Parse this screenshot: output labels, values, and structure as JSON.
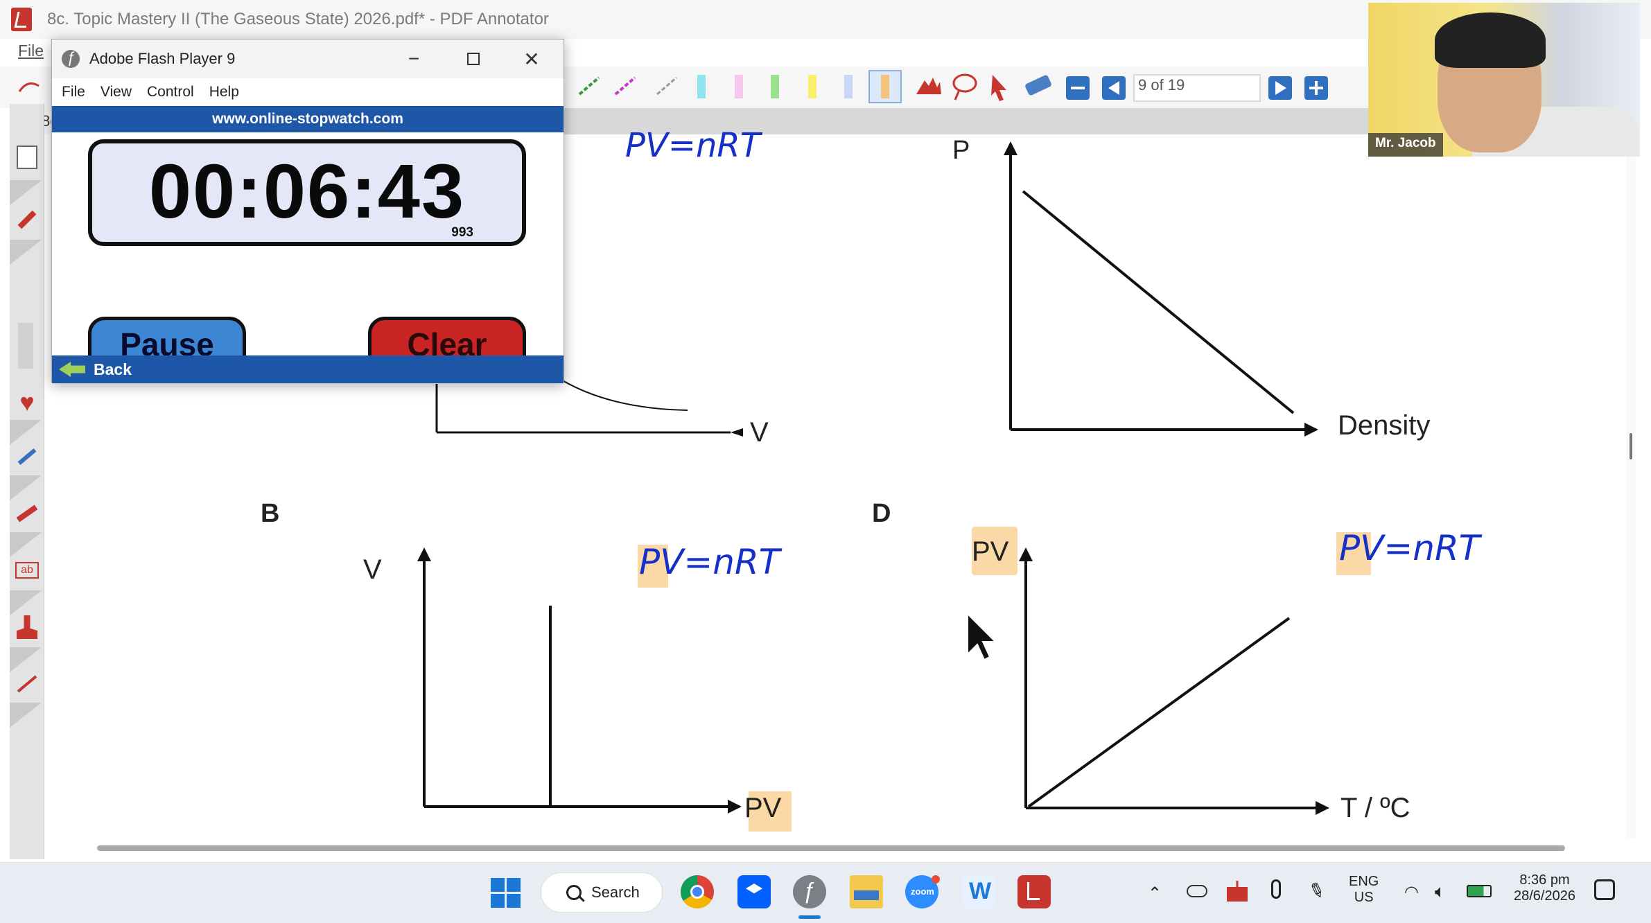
{
  "app": {
    "title": "8c. Topic Mastery II (The Gaseous State) 2026.pdf* - PDF Annotator",
    "menu_file": "File",
    "tab_label": "8c",
    "page_indicator": "9 of 19"
  },
  "flash_window": {
    "title": "Adobe Flash Player 9",
    "menu": [
      "File",
      "View",
      "Control",
      "Help"
    ],
    "site": "www.online-stopwatch.com",
    "time": "00:06:43",
    "milliseconds": "993",
    "pause_label": "Pause",
    "clear_label": "Clear",
    "back_label": "Back"
  },
  "webcam": {
    "name": "Mr. Jacob"
  },
  "document": {
    "handwriting_top": "PV=nRT",
    "graph_a": {
      "x_label": "V"
    },
    "graph_c": {
      "y_label": "P",
      "x_label": "Density"
    },
    "graph_b": {
      "letter": "B",
      "y_label": "V",
      "x_label": "PV",
      "note": "PV=nRT"
    },
    "graph_d": {
      "letter": "D",
      "y_label": "PV",
      "x_label": "T / ºC",
      "note": "PV=nRT"
    }
  },
  "taskbar": {
    "search_label": "Search",
    "lang_top": "ENG",
    "lang_bottom": "US",
    "time": "8:36 pm",
    "date": "28/6/2026",
    "apps": [
      "start",
      "chrome",
      "dropbox",
      "flash",
      "file-explorer",
      "zoom",
      "w-app",
      "pdf-annotator"
    ]
  },
  "colors": {
    "ink_blue": "#1430c8",
    "highlight": "#fbd9a6",
    "flash_blue": "#1e56a8",
    "pause_blue": "#3c86d4",
    "clear_red": "#c92524"
  }
}
